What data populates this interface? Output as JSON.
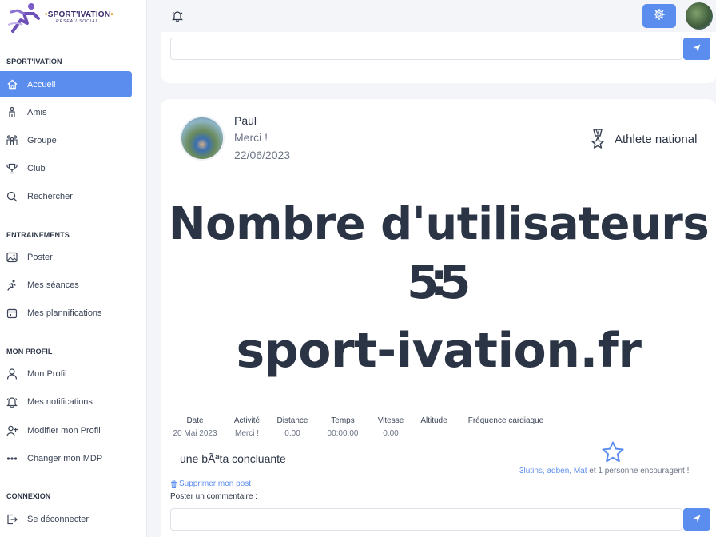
{
  "logo": {
    "title_left": "SPORT'IVATION",
    "subtitle": "RÉSEAU SOCIAL"
  },
  "sidebar": {
    "sections": [
      {
        "title": "SPORT'IVATION",
        "items": [
          {
            "label": "Accueil",
            "icon": "home-icon",
            "active": true
          },
          {
            "label": "Amis",
            "icon": "person-icon"
          },
          {
            "label": "Groupe",
            "icon": "group-icon"
          },
          {
            "label": "Club",
            "icon": "trophy-icon"
          },
          {
            "label": "Rechercher",
            "icon": "search-icon"
          }
        ]
      },
      {
        "title": "ENTRAINEMENTS",
        "items": [
          {
            "label": "Poster",
            "icon": "image-icon"
          },
          {
            "label": "Mes séances",
            "icon": "running-icon"
          },
          {
            "label": "Mes plannifications",
            "icon": "calendar-icon"
          }
        ]
      },
      {
        "title": "MON PROFIL",
        "items": [
          {
            "label": "Mon Profil",
            "icon": "user-icon"
          },
          {
            "label": "Mes notifications",
            "icon": "bell-icon"
          },
          {
            "label": "Modifier mon Profil",
            "icon": "user-plus-icon"
          },
          {
            "label": "Changer mon MDP",
            "icon": "dots-icon"
          }
        ]
      },
      {
        "title": "CONNEXION",
        "items": [
          {
            "label": "Se déconnecter",
            "icon": "logout-icon"
          }
        ]
      }
    ]
  },
  "colors": {
    "accent": "#5b8def",
    "text": "#2b3445",
    "muted": "#6b7385",
    "background": "#f4f5f8"
  },
  "post": {
    "author": "Paul",
    "message": "Merci !",
    "date": "22/06/2023",
    "badge": "Athlete national",
    "image_text_line1": "Nombre d'utilisateurs :",
    "image_text_line2": "55",
    "image_text_line3": "sport-ivation.fr",
    "stats": {
      "headers": [
        "Date",
        "Activité",
        "Distance",
        "Temps",
        "Vitesse",
        "Altitude",
        "Fréquence cardiaque"
      ],
      "values": [
        "20 Mai 2023",
        "Merci !",
        "0.00",
        "00:00:00",
        "0.00",
        "",
        ""
      ]
    },
    "caption": "une bÃªta concluante",
    "encourage_names": "3lutins, adben, Mat",
    "encourage_rest": " et 1 personne encouragent !",
    "delete_label": "Supprimer mon post",
    "comment_label": "Poster un commentaire :"
  }
}
